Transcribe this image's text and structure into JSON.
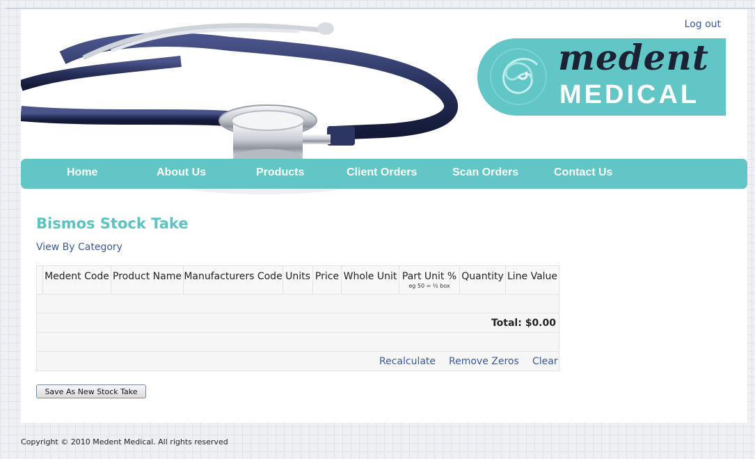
{
  "header": {
    "logout_label": "Log out",
    "logo_top": "medent",
    "logo_bottom": "MEDICAL"
  },
  "nav": {
    "items": [
      {
        "label": "Home"
      },
      {
        "label": "About Us"
      },
      {
        "label": "Products"
      },
      {
        "label": "Client Orders"
      },
      {
        "label": "Scan Orders"
      },
      {
        "label": "Contact Us"
      }
    ]
  },
  "main": {
    "title": "Bismos Stock Take",
    "view_by_category": "View By Category",
    "table": {
      "columns": [
        {
          "label": "Medent Code"
        },
        {
          "label": "Product Name"
        },
        {
          "label": "Manufacturers Code"
        },
        {
          "label": "Units"
        },
        {
          "label": "Price"
        },
        {
          "label": "Whole Unit"
        },
        {
          "label": "Part Unit %",
          "note": "eg 50 = ½ box"
        },
        {
          "label": "Quantity"
        },
        {
          "label": "Line Value"
        }
      ],
      "total_label": "Total: $0.00",
      "actions": {
        "recalculate": "Recalculate",
        "remove_zeros": "Remove Zeros",
        "clear": "Clear"
      }
    },
    "save_button": "Save As New Stock Take"
  },
  "footer": {
    "copyright": "Copyright © 2010 Medent Medical. All rights reserved"
  },
  "colors": {
    "accent": "#62c6c7",
    "title": "#5bc3c4",
    "link": "#3a5a9a",
    "steth_tube": "#27305a"
  }
}
